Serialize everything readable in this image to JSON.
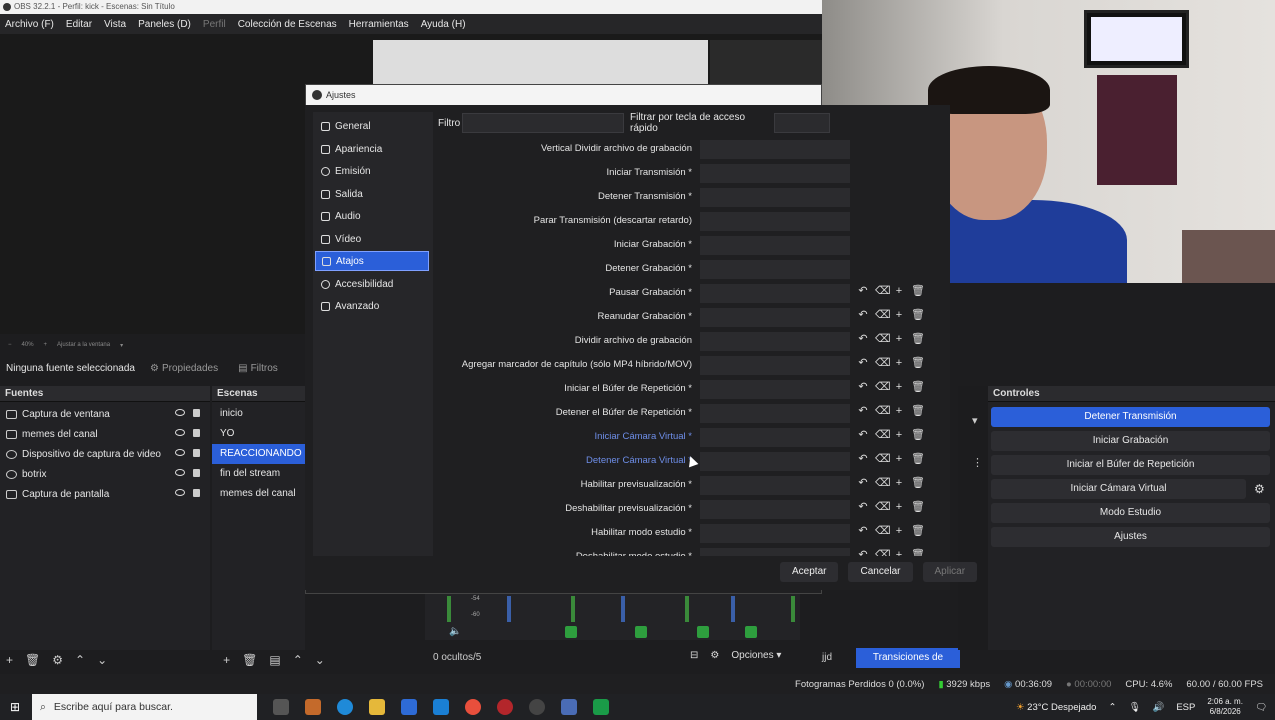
{
  "window": {
    "title": "OBS 32.2.1 - Perfil: kick - Escenas: Sin Título"
  },
  "menu": [
    "Archivo (F)",
    "Editar",
    "Vista",
    "Paneles (D)",
    "Perfil",
    "Colección de Escenas",
    "Herramientas",
    "Ayuda (H)"
  ],
  "zoom": {
    "percent": "40%",
    "fit": "Ajustar a la ventana"
  },
  "source_toolbar": {
    "none_selected": "Ninguna fuente seleccionada",
    "properties": "Propiedades",
    "filters": "Filtros"
  },
  "fuentes": {
    "title": "Fuentes",
    "items": [
      "Captura de ventana",
      "memes del canal",
      "Dispositivo de captura de video",
      "botrix",
      "Captura de pantalla"
    ]
  },
  "escenas": {
    "title": "Escenas",
    "items": [
      "inicio",
      "YO",
      "REACCIONANDO",
      "fin del stream",
      "memes del canal"
    ],
    "selected": "REACCIONANDO"
  },
  "mixer": {
    "hidden": "0 ocultos/5",
    "options": "Opciones",
    "db_label": "-54",
    "db_label2": "-60"
  },
  "transitions": {
    "label": "jjd",
    "button": "Transiciones de escena"
  },
  "controles": {
    "title": "Controles",
    "buttons": [
      "Detener Transmisión",
      "Iniciar Grabación",
      "Iniciar el Búfer de Repetición",
      "Iniciar Cámara Virtual",
      "Modo Estudio",
      "Ajustes"
    ]
  },
  "status": {
    "dropped": "Fotogramas Perdidos 0 (0.0%)",
    "bitrate": "3929 kbps",
    "live": "00:36:09",
    "rec": "00:00:00",
    "cpu": "CPU: 4.6%",
    "fps": "60.00 / 60.00 FPS"
  },
  "taskbar": {
    "search": "Escribe aquí para buscar.",
    "weather": "23°C Despejado",
    "lang": "ESP",
    "time": "2:06 a. m.",
    "date": "6/8/2026"
  },
  "settings": {
    "title": "Ajustes",
    "categories": [
      "General",
      "Apariencia",
      "Emisión",
      "Salida",
      "Audio",
      "Vídeo",
      "Atajos",
      "Accesibilidad",
      "Avanzado"
    ],
    "selected_category": "Atajos",
    "filter_label": "Filtro",
    "hotkey_filter_label": "Filtrar por tecla de acceso rápido",
    "hotkeys": [
      "Vertical Dividir archivo de grabación",
      "Iniciar Transmisión *",
      "Detener Transmisión *",
      "Parar Transmisión (descartar retardo)",
      "Iniciar Grabación *",
      "Detener Grabación *",
      "Pausar Grabación *",
      "Reanudar Grabación *",
      "Dividir archivo de grabación",
      "Agregar marcador de capítulo (sólo MP4 híbrido/MOV)",
      "Iniciar el Búfer de Repetición *",
      "Detener el Búfer de Repetición *",
      "Iniciar Cámara Virtual *",
      "Detener Cámara Virtual *",
      "Habilitar previsualización *",
      "Deshabilitar previsualización *",
      "Habilitar modo estudio *",
      "Deshabilitar modo estudio *"
    ],
    "buttons": {
      "ok": "Aceptar",
      "cancel": "Cancelar",
      "apply": "Aplicar"
    }
  }
}
